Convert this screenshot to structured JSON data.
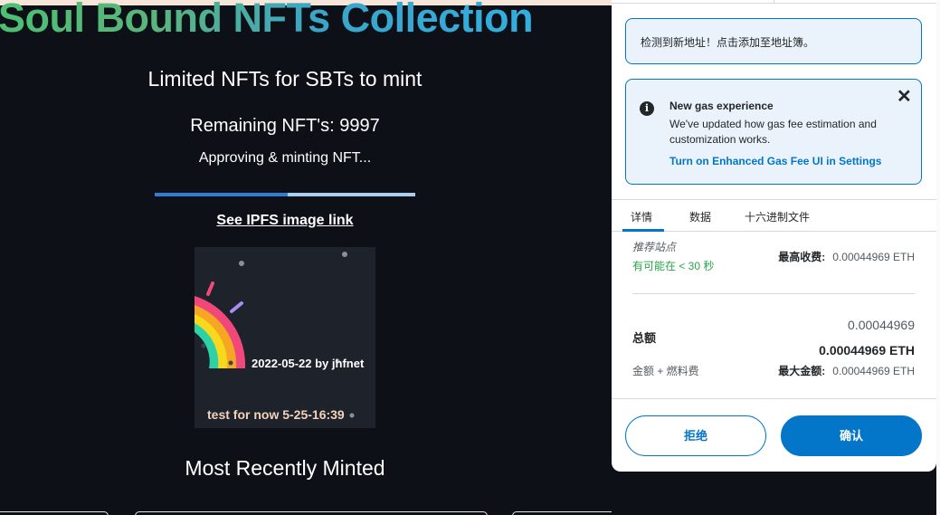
{
  "dapp": {
    "title": "Soul Bound NFTs Collection",
    "subtitle": "Limited NFTs for SBTs to mint",
    "remaining": "Remaining NFT's: 9997",
    "status": "Approving & minting NFT...",
    "progress": 0.51,
    "ipfs_link": "See IPFS image link",
    "nft": {
      "date_line": "2022-05-22 by jhfnet",
      "caption": "test for now 5-25-16:39"
    },
    "recent_heading": "Most Recently Minted"
  },
  "wallet": {
    "notice": "检测到新地址！点击添加至地址簿。",
    "gas": {
      "title": "New gas experience",
      "body": "We've updated how gas fee estimation and customization works.",
      "link": "Turn on Enhanced Gas Fee UI in Settings"
    },
    "tabs": [
      "详情",
      "数据",
      "十六进制文件"
    ],
    "site_label": "推荐站点",
    "site_time": "有可能在 < 30 秒",
    "max_fee_label": "最高收费:",
    "max_fee_value": "0.00044969 ETH",
    "total_label": "总额",
    "total_amount": "0.00044969",
    "total_eth": "0.00044969 ETH",
    "sub_label": "金额 + 燃料费",
    "max_amount_label": "最大金额:",
    "max_amount_value": "0.00044969 ETH",
    "reject": "拒绝",
    "confirm": "确认"
  },
  "colors": {
    "accent": "#0376c9",
    "page_bg": "#0d1117",
    "success": "#28a745"
  },
  "icons": [
    "info-icon",
    "close-icon"
  ]
}
